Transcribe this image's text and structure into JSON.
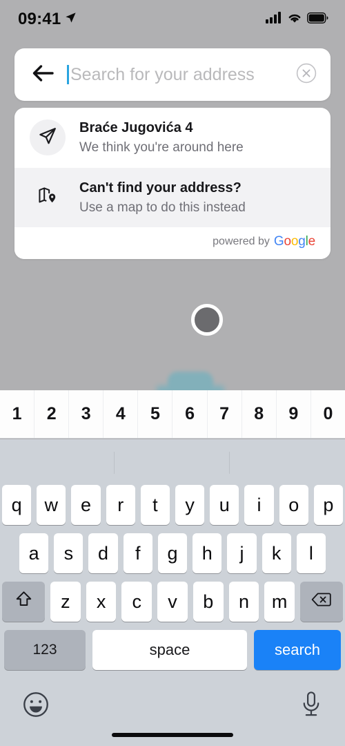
{
  "status_bar": {
    "time": "09:41",
    "location_icon": "location-arrow-icon",
    "signal_icon": "cellular-signal-icon",
    "wifi_icon": "wifi-icon",
    "battery_icon": "battery-full-icon"
  },
  "search": {
    "back_icon": "back-arrow-icon",
    "placeholder": "Search for your address",
    "value": "",
    "clear_icon": "clear-circle-icon",
    "caret_color": "#29a4e0"
  },
  "suggestions": {
    "items": [
      {
        "icon": "navigation-arrow-icon",
        "title": "Braće Jugovića 4",
        "subtitle": "We think you're around here",
        "highlighted": false
      },
      {
        "icon": "map-pin-icon",
        "title": "Can't find your address?",
        "subtitle": "Use a map to do this instead",
        "highlighted": true
      }
    ],
    "attribution": {
      "label": "powered by",
      "brand": "Google",
      "brand_letters": [
        {
          "char": "G",
          "color": "#4285f4"
        },
        {
          "char": "o",
          "color": "#ea4335"
        },
        {
          "char": "o",
          "color": "#fbbc05"
        },
        {
          "char": "g",
          "color": "#4285f4"
        },
        {
          "char": "l",
          "color": "#34a853"
        },
        {
          "char": "e",
          "color": "#ea4335"
        }
      ]
    }
  },
  "map": {
    "marker": "location-marker-dot",
    "overlay_color": "#b0b0b2",
    "blob_color": "#7fb0bb"
  },
  "keyboard": {
    "number_row": [
      "1",
      "2",
      "3",
      "4",
      "5",
      "6",
      "7",
      "8",
      "9",
      "0"
    ],
    "row1": [
      "q",
      "w",
      "e",
      "r",
      "t",
      "y",
      "u",
      "i",
      "o",
      "p"
    ],
    "row2": [
      "a",
      "s",
      "d",
      "f",
      "g",
      "h",
      "j",
      "k",
      "l"
    ],
    "row3": [
      "z",
      "x",
      "c",
      "v",
      "b",
      "n",
      "m"
    ],
    "shift_icon": "shift-arrow-icon",
    "backspace_icon": "backspace-delete-icon",
    "numeric_label": "123",
    "space_label": "space",
    "action_label": "search",
    "action_color": "#1a82f7",
    "emoji_icon": "emoji-smiley-icon",
    "dictation_icon": "microphone-icon"
  }
}
